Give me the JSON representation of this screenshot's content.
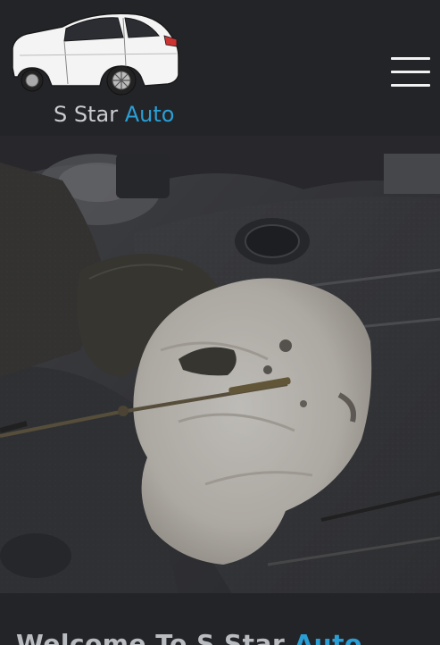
{
  "header": {
    "brand_primary": "S Star",
    "brand_accent": "Auto",
    "logo_icon": "car-logo-icon",
    "menu_icon": "hamburger-menu-icon"
  },
  "hero": {
    "image_subject": "hand-with-rag-and-dipstick-engine"
  },
  "welcome": {
    "prefix": "Welcome To S Star",
    "accent": "Auto"
  },
  "colors": {
    "background": "#232428",
    "accent": "#2a9fd6",
    "text_light": "#c9ccd0"
  }
}
